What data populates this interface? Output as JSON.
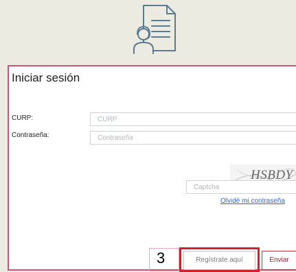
{
  "login": {
    "title": "Iniciar sesión",
    "curp_label": "CURP:",
    "curp_placeholder": "CURP",
    "password_label": "Contraseña:",
    "password_placeholder": "Contraseña",
    "captcha_text": "HSBDY",
    "captcha_placeholder": "Captcha",
    "forgot_link": "Olvidé mi contraseña",
    "register_button": "Regístrate aquí",
    "send_button": "Enviar"
  },
  "annotation": {
    "step_number": "3"
  },
  "icons": {
    "header": "user-document-icon"
  },
  "colors": {
    "background": "#ecebe2",
    "panel_border": "#c95574",
    "highlight": "#d11f2c",
    "link": "#2f66c4",
    "send_text": "#9a1b2e",
    "icon_stroke": "#5a7a90"
  }
}
